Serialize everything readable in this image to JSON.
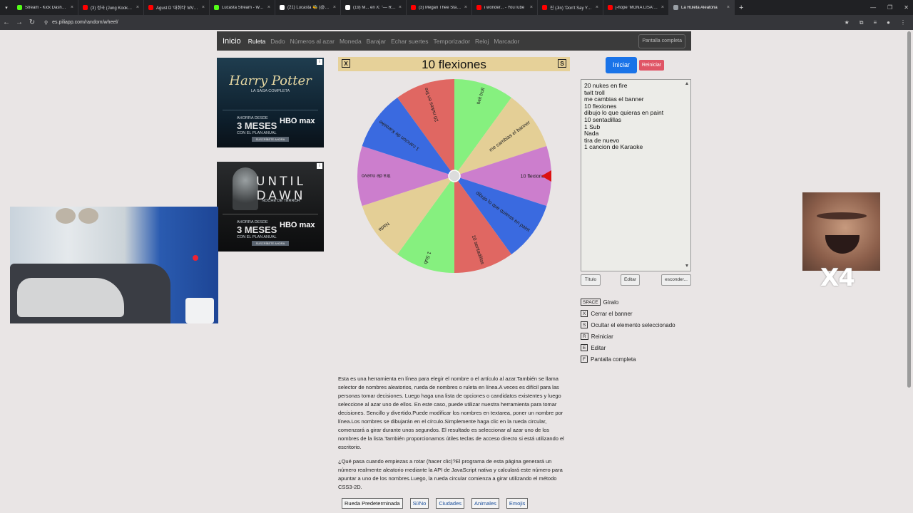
{
  "browser": {
    "tabs": [
      {
        "title": "Stream - Kick Dashboard",
        "color": "#53fc18"
      },
      {
        "title": "(3) 정국 (Jung Kook) Live ...",
        "color": "#ff0000"
      },
      {
        "title": "Agust D '대취타' MV - Yo...",
        "color": "#ff0000"
      },
      {
        "title": "Lucasta Stream - Watch L...",
        "color": "#53fc18"
      },
      {
        "title": "(21) Lucasta 🐝 (@Lucasta...",
        "color": "#ffffff"
      },
      {
        "title": "(19) M... en X: \"— Regi...",
        "color": "#ffffff"
      },
      {
        "title": "(3) Megan Thee Stallion - ...",
        "color": "#ff0000"
      },
      {
        "title": "i wonder... - YouTube",
        "color": "#ff0000"
      },
      {
        "title": "진 (Jin) 'Don't Say You Lo...",
        "color": "#ff0000"
      },
      {
        "title": "j-hope 'MONA LISA' Offi...",
        "color": "#ff0000"
      },
      {
        "title": "La Ruleta Aleatoria",
        "color": "#9aa0a6"
      }
    ],
    "close_glyph": "×",
    "new_tab_glyph": "+",
    "url": "es.piliapp.com/random/wheel/"
  },
  "site_nav": {
    "brand": "Inicio",
    "links": [
      "Ruleta",
      "Dado",
      "Números al azar",
      "Moneda",
      "Barajar",
      "Echar suertes",
      "Temporizador",
      "Reloj",
      "Marcador"
    ],
    "fullscreen": "Pantalla completa"
  },
  "ads": {
    "ad1": {
      "title": "Harry Potter",
      "subtitle": "LA SAGA COMPLETA",
      "line1": "AHORRA DESDE",
      "big": "3 MESES",
      "line2": "CON EL PLAN ANUAL",
      "brand": "HBO max",
      "cta": "SUSCRÍBETE AHORA"
    },
    "ad2": {
      "title": "UNTIL DAWN",
      "subtitle": "NOCHE DE TERROR",
      "line1": "AHORRA DESDE",
      "big": "3 MESES",
      "line2": "CON EL PLAN ANUAL",
      "brand": "HBO max",
      "cta": "SUSCRÍBETE AHORA"
    }
  },
  "wheel": {
    "close_key": "X",
    "result": "10 flexiones",
    "shortcut_key": "S",
    "colors": [
      "#e06762",
      "#86f07f",
      "#e4cf96",
      "#cc7ecd",
      "#3a6ae0"
    ],
    "pointer_color": "#dd1111"
  },
  "controls": {
    "start": "Iniciar",
    "reset": "Reiniciar",
    "names": [
      "20 nukes en fire",
      "twit troll",
      "me cambias el banner",
      "10 flexiones",
      "dibujo lo que quieras en paint",
      "10 sentadillas",
      "1 Sub",
      "Nada",
      "tira de nuevo",
      "1 cancion de Karaoke"
    ],
    "title_btn": "Título",
    "edit_btn": "Editar",
    "hide_btn": "esconder..."
  },
  "shortcuts": [
    {
      "key": "SPACE",
      "label": "Gíralo"
    },
    {
      "key": "X",
      "label": "Cerrar el banner"
    },
    {
      "key": "S",
      "label": "Ocultar el elemento seleccionado"
    },
    {
      "key": "R",
      "label": "Reiniciar"
    },
    {
      "key": "E",
      "label": "Editar"
    },
    {
      "key": "F",
      "label": "Pantalla completa"
    }
  ],
  "overlay": {
    "label": "X4"
  },
  "description": {
    "p1": "Esta es una herramienta en línea para elegir el nombre o el artículo al azar.También se llama selector de nombres aleatorios, rueda de nombres o ruleta en línea.A veces es difícil para las personas tomar decisiones. Luego haga una lista de opciones o candidatos existentes y luego seleccione al azar uno de ellos. En este caso, puede utilizar nuestra herramienta para tomar decisiones. Sencillo y divertido.Puede modificar los nombres en textarea, poner un nombre por línea.Los nombres se dibujarán en el círculo.Simplemente haga clic en la rueda circular, comenzará a girar durante unos segundos. El resultado es seleccionar al azar uno de los nombres de la lista.También proporcionamos útiles teclas de acceso directo si está utilizando el escritorio.",
    "p2": "¿Qué pasa cuando empiezas a rotar (hacer clic)?El programa de esta página generará un número realmente aleatorio mediante la API de JavaScript nativa y calculará este número para apuntar a uno de los nombres.Luego, la rueda circular comienza a girar utilizando el método CSS3-2D."
  },
  "presets": [
    "Rueda Predeterminada",
    "Sí/No",
    "Ciudades",
    "Animales",
    "Emojis"
  ]
}
